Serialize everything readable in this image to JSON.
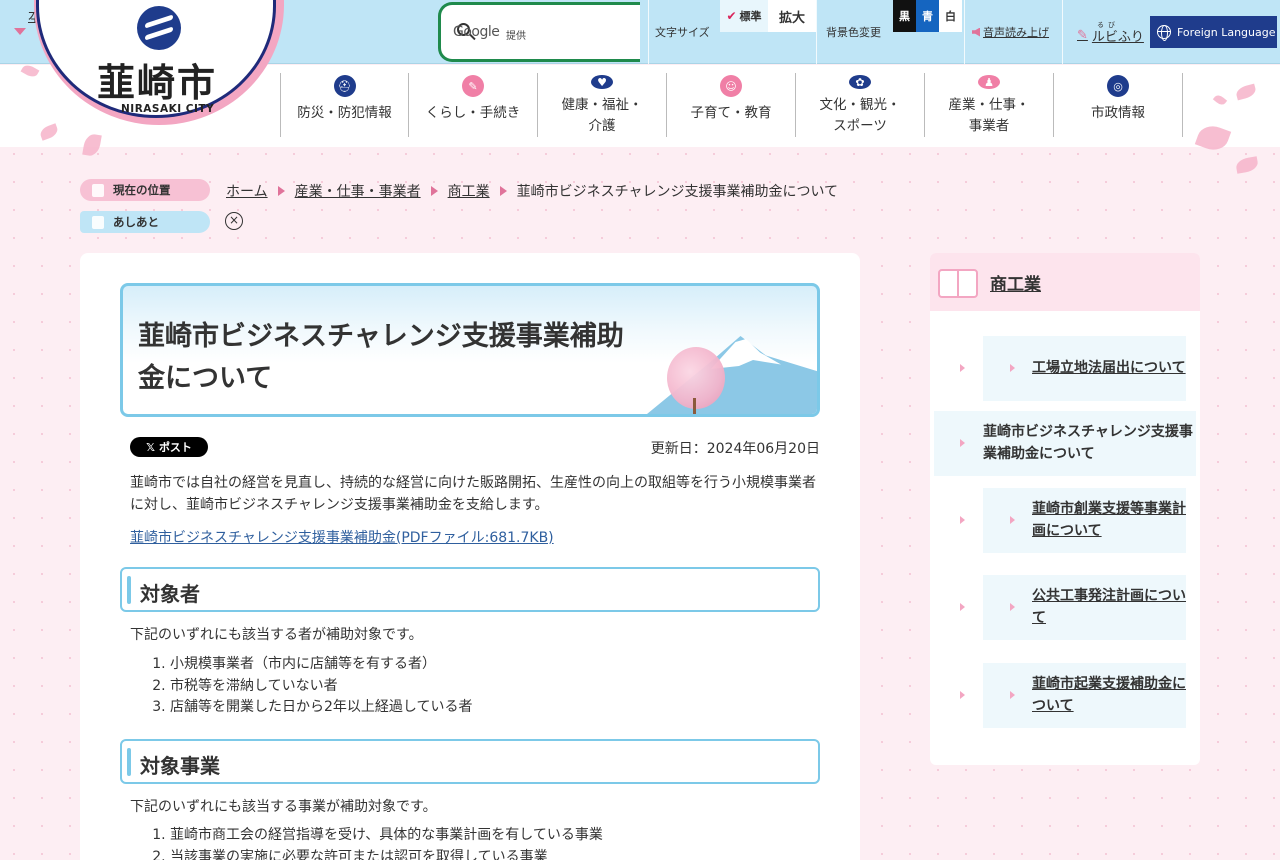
{
  "header": {
    "skip_link": "本文へ",
    "logo_text": "韮崎市",
    "logo_sub": "NIRASAKI CITY",
    "search": {
      "logo": "Google",
      "provided": "提供"
    },
    "font_size": {
      "label": "文字サイズ",
      "standard": "標準",
      "large": "拡大"
    },
    "background": {
      "label": "背景色変更",
      "black": "黒",
      "blue": "青",
      "white": "白"
    },
    "voice": "音声読み上げ",
    "ruby": "ルビふり",
    "ruby_reading": "るび",
    "foreign": "Foreign Language"
  },
  "nav": [
    {
      "label": "防災・防犯情報",
      "icon": "helmet-icon",
      "color": "#1f3c8c"
    },
    {
      "label": "くらし・手続き",
      "icon": "document-icon",
      "color": "#f07fa6"
    },
    {
      "label": "健康・福祉・\n介護",
      "icon": "heart-hands-icon",
      "color": "#1f3c8c"
    },
    {
      "label": "子育て・教育",
      "icon": "child-icon",
      "color": "#f07fa6"
    },
    {
      "label": "文化・観光・\nスポーツ",
      "icon": "culture-icon",
      "color": "#1f3c8c"
    },
    {
      "label": "産業・仕事・\n事業者",
      "icon": "worker-icon",
      "color": "#f07fa6"
    },
    {
      "label": "市政情報",
      "icon": "city-emblem-icon",
      "color": "#1f3c8c"
    }
  ],
  "breadcrumb": {
    "tag": "現在の位置",
    "items": [
      "ホーム",
      "産業・仕事・事業者",
      "商工業"
    ],
    "current": "韮崎市ビジネスチャレンジ支援事業補助金について"
  },
  "history": {
    "tag": "あしあと",
    "clear": "×"
  },
  "article": {
    "title": "韮崎市ビジネスチャレンジ支援事業補助金について",
    "post_button": "ポスト",
    "updated": "更新日：2024年06月20日",
    "intro": "韮崎市では自社の経営を見直し、持続的な経営に向けた販路開拓、生産性の向上の取組等を行う小規模事業者に対し、韮崎市ビジネスチャレンジ支援事業補助金を支給します。",
    "pdf_link": "韮崎市ビジネスチャレンジ支援事業補助金(PDFファイル:681.7KB)",
    "sections": [
      {
        "heading": "対象者",
        "text": "下記のいずれにも該当する者が補助対象です。",
        "items": [
          "小規模事業者（市内に店舗等を有する者）",
          "市税等を滞納していない者",
          "店舗等を開業した日から2年以上経過している者"
        ]
      },
      {
        "heading": "対象事業",
        "text": "下記のいずれにも該当する事業が補助対象です。",
        "items": [
          "韮崎市商工会の経営指導を受け、具体的な事業計画を有している事業",
          "当該事業の実施に必要な許可または認可を取得している事業"
        ]
      }
    ]
  },
  "side": {
    "title": "商工業",
    "items": [
      "工場立地法届出について",
      "韮崎市ビジネスチャレンジ支援事業補助金について",
      "韮崎市創業支援等事業計画について",
      "公共工事発注計画について",
      "韮崎市起業支援補助金について"
    ]
  }
}
